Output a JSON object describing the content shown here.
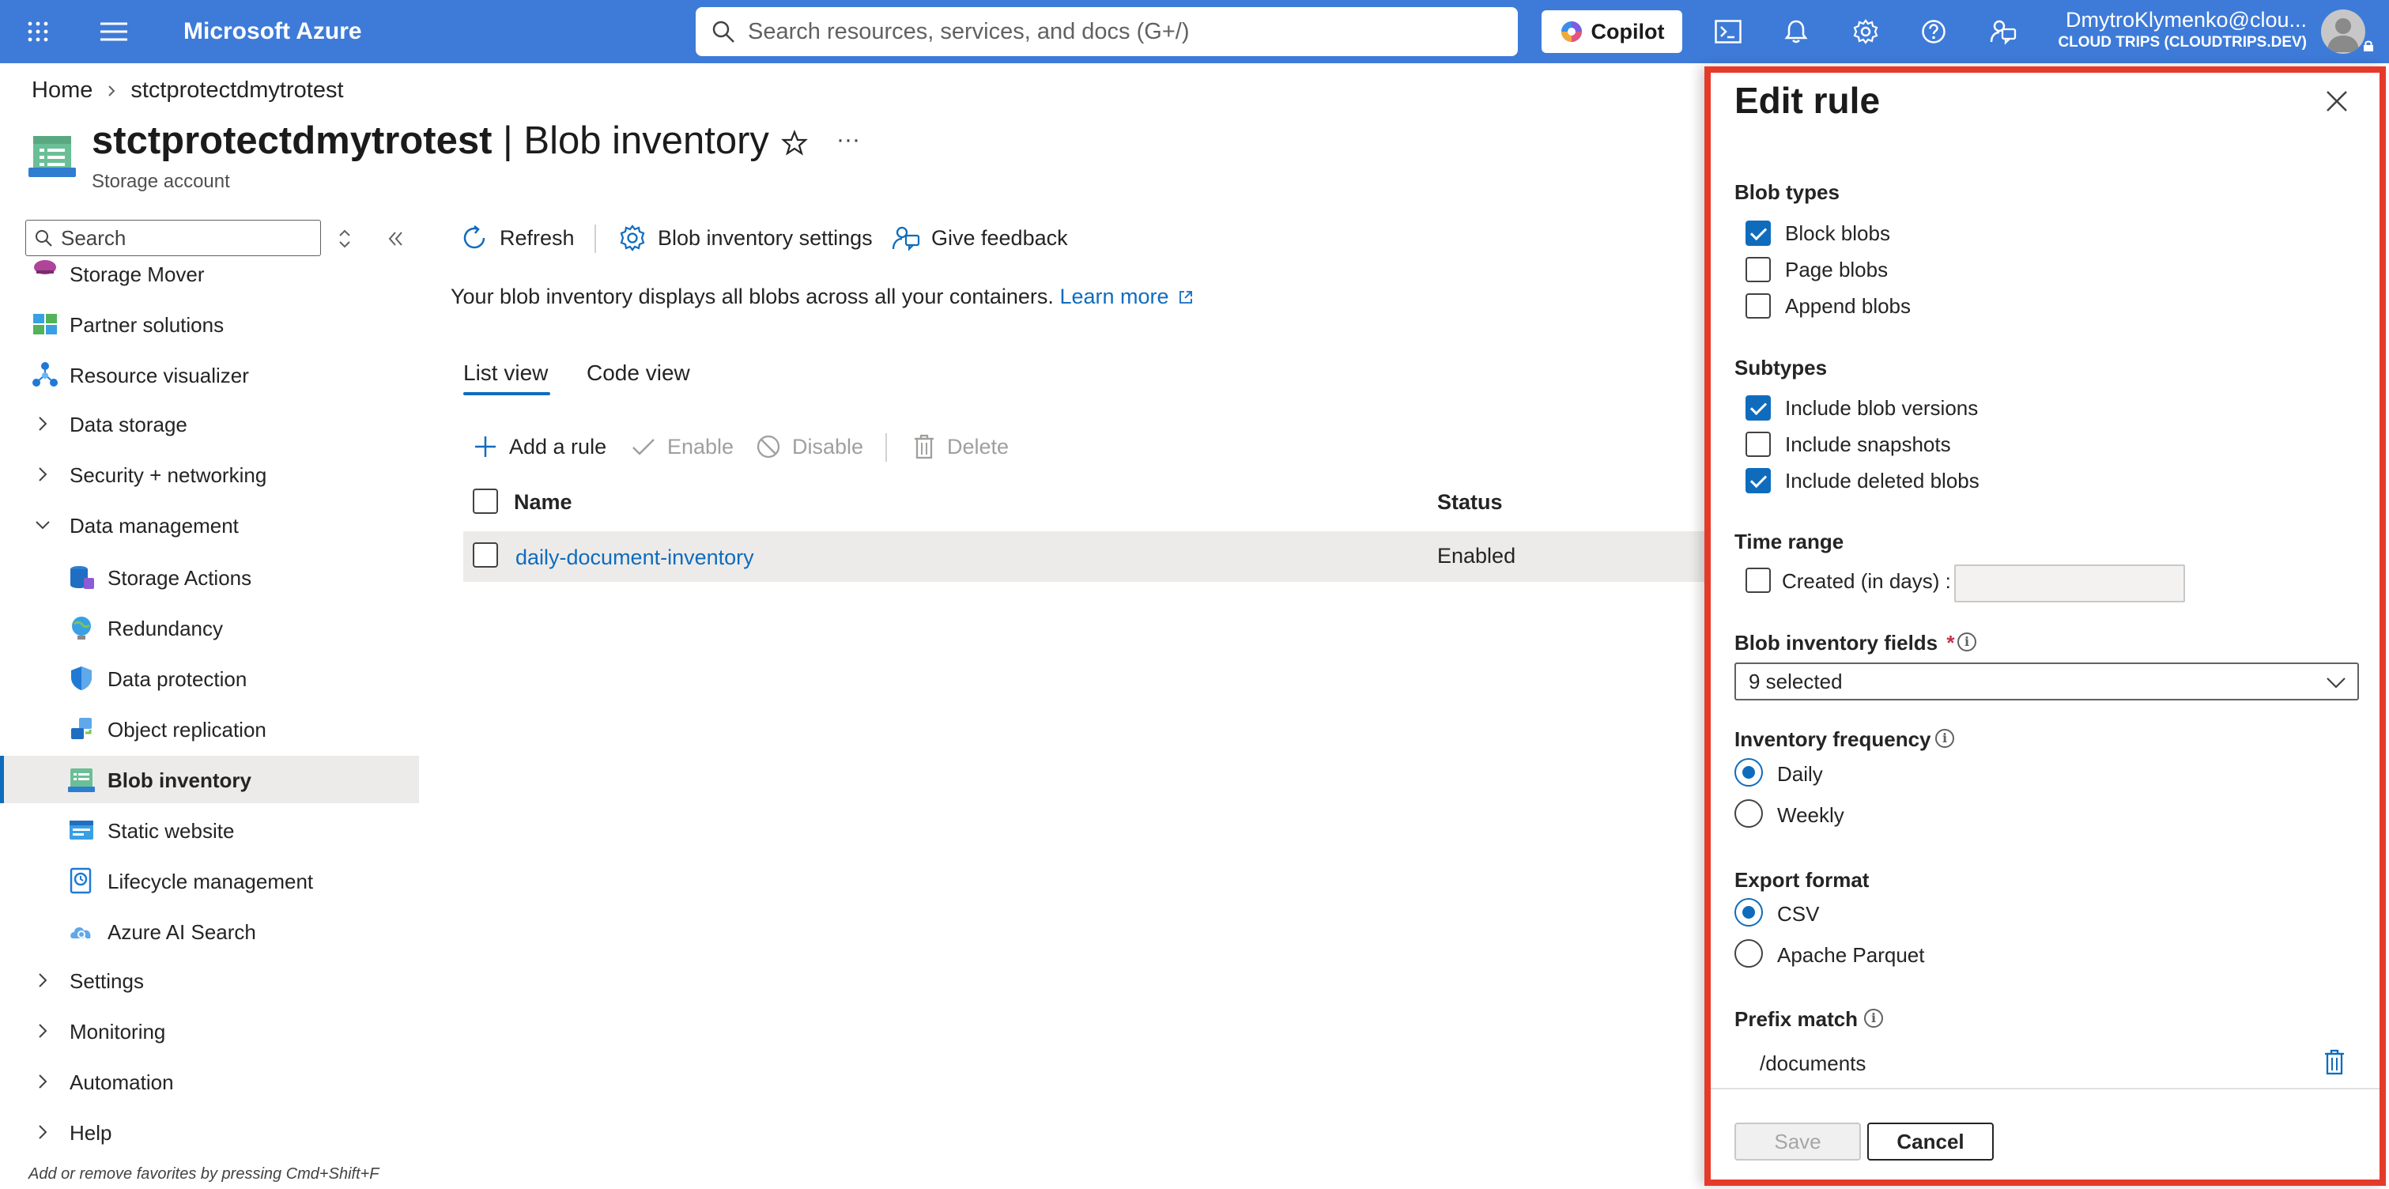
{
  "topbar": {
    "brand": "Microsoft Azure",
    "search_placeholder": "Search resources, services, and docs (G+/)",
    "copilot_label": "Copilot",
    "user_name": "DmytroKlymenko@clou...",
    "tenant": "CLOUD TRIPS (CLOUDTRIPS.DEV)",
    "accent": "#3e7bd8"
  },
  "breadcrumb": {
    "home": "Home",
    "resource": "stctprotectdmytrotest"
  },
  "header": {
    "resource_name": "stctprotectdmytrotest",
    "separator": " | ",
    "page": "Blob inventory",
    "subtitle": "Storage account",
    "more": "···"
  },
  "menu": {
    "search_placeholder": "Search",
    "items": [
      {
        "label": "Storage Mover",
        "icon": "storage-mover-icon"
      },
      {
        "label": "Partner solutions",
        "icon": "partner-solutions-icon"
      },
      {
        "label": "Resource visualizer",
        "icon": "resource-visualizer-icon"
      },
      {
        "label": "Data storage",
        "icon": "chevron-right-icon"
      },
      {
        "label": "Security + networking",
        "icon": "chevron-right-icon"
      },
      {
        "label": "Data management",
        "icon": "chevron-down-icon"
      },
      {
        "label": "Storage Actions",
        "icon": "storage-actions-icon"
      },
      {
        "label": "Redundancy",
        "icon": "redundancy-icon"
      },
      {
        "label": "Data protection",
        "icon": "shield-icon"
      },
      {
        "label": "Object replication",
        "icon": "object-replication-icon"
      },
      {
        "label": "Blob inventory",
        "icon": "blob-inventory-icon"
      },
      {
        "label": "Static website",
        "icon": "static-website-icon"
      },
      {
        "label": "Lifecycle management",
        "icon": "lifecycle-icon"
      },
      {
        "label": "Azure AI Search",
        "icon": "ai-search-icon"
      },
      {
        "label": "Settings",
        "icon": "chevron-right-icon"
      },
      {
        "label": "Monitoring",
        "icon": "chevron-right-icon"
      },
      {
        "label": "Automation",
        "icon": "chevron-right-icon"
      },
      {
        "label": "Help",
        "icon": "chevron-right-icon"
      }
    ],
    "favorites_hint": "Add or remove favorites by pressing Cmd+Shift+F"
  },
  "toolbar": {
    "refresh": "Refresh",
    "settings": "Blob inventory settings",
    "feedback": "Give feedback"
  },
  "main": {
    "info_text": "Your blob inventory displays all blobs across all your containers.",
    "learn_more": "Learn more",
    "tabs": [
      {
        "label": "List view",
        "selected": true
      },
      {
        "label": "Code view",
        "selected": false
      }
    ],
    "actions": {
      "add": "Add a rule",
      "enable": "Enable",
      "disable": "Disable",
      "delete": "Delete"
    },
    "table": {
      "columns": [
        "Name",
        "Status"
      ],
      "rows": [
        {
          "name": "daily-document-inventory",
          "status": "Enabled"
        }
      ]
    }
  },
  "panel": {
    "title": "Edit rule",
    "blob_types": {
      "label": "Blob types",
      "options": [
        {
          "label": "Block blobs",
          "checked": true
        },
        {
          "label": "Page blobs",
          "checked": false
        },
        {
          "label": "Append blobs",
          "checked": false
        }
      ]
    },
    "subtypes": {
      "label": "Subtypes",
      "options": [
        {
          "label": "Include blob versions",
          "checked": true
        },
        {
          "label": "Include snapshots",
          "checked": false
        },
        {
          "label": "Include deleted blobs",
          "checked": true
        }
      ]
    },
    "time_range": {
      "label": "Time range",
      "created_label": "Created (in days) :",
      "checked": false,
      "value": ""
    },
    "fields": {
      "label": "Blob inventory fields",
      "required_mark": "*",
      "value": "9 selected"
    },
    "frequency": {
      "label": "Inventory frequency",
      "options": [
        {
          "label": "Daily",
          "selected": true
        },
        {
          "label": "Weekly",
          "selected": false
        }
      ]
    },
    "export_format": {
      "label": "Export format",
      "options": [
        {
          "label": "CSV",
          "selected": true
        },
        {
          "label": "Apache Parquet",
          "selected": false
        }
      ]
    },
    "prefix_match": {
      "label": "Prefix match",
      "value": "/documents"
    },
    "save": "Save",
    "cancel": "Cancel",
    "highlight_color": "#e53a2a"
  }
}
